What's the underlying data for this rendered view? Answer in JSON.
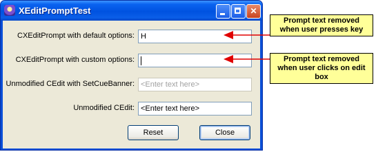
{
  "window": {
    "title": "XEditPromptTest"
  },
  "titlebar": {
    "minimize_icon": "minimize-icon",
    "maximize_icon": "maximize-icon",
    "close_icon": "close-icon",
    "close_glyph": "✕"
  },
  "fields": [
    {
      "label": "CXEditPrompt with default options:",
      "value": "H",
      "enabled": true
    },
    {
      "label": "CXEditPrompt with custom options:",
      "value": "",
      "enabled": true,
      "caret": true
    },
    {
      "label": "Unmodified CEdit with SetCueBanner:",
      "value": "",
      "placeholder": "<Enter text here>",
      "enabled": false
    },
    {
      "label": "Unmodified CEdit:",
      "value": "<Enter text here>",
      "enabled": true
    }
  ],
  "buttons": {
    "reset": "Reset",
    "close": "Close"
  },
  "annotations": [
    {
      "text": "Prompt text removed when user presses key"
    },
    {
      "text": "Prompt text removed when user clicks on edit box"
    }
  ],
  "colors": {
    "titlebar": "#0a5ee8",
    "dialog_bg": "#ece9d8",
    "note_bg": "#ffff99",
    "arrow": "#e00000"
  }
}
